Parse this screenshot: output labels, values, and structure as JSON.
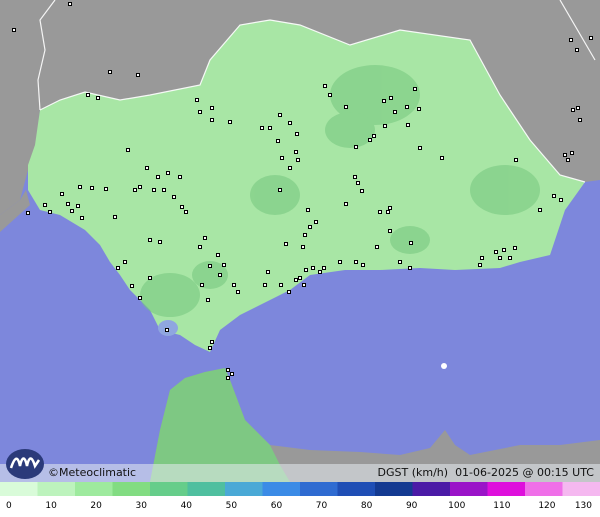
{
  "brand": {
    "name": "Meteoclimatic",
    "copyright_symbol": "©"
  },
  "stamp": {
    "variable": "DGST (km/h)",
    "datetime": "01-06-2025 @ 00:15 UTC"
  },
  "legend": {
    "ticks": [
      "0",
      "10",
      "20",
      "30",
      "40",
      "50",
      "60",
      "70",
      "80",
      "90",
      "100",
      "110",
      "120",
      "130"
    ],
    "colors": [
      "#d9fbd9",
      "#bdf3bd",
      "#9eea9e",
      "#82dc82",
      "#66cd8a",
      "#4fbf9f",
      "#4aa9d6",
      "#3b8be6",
      "#2f6bd1",
      "#1f4eb5",
      "#143a91",
      "#4b1aa6",
      "#9a14c8",
      "#de0fdc",
      "#ef6fe8",
      "#f5b8f0"
    ]
  },
  "colors": {
    "sea": "#7d87dc",
    "land_outside": "#9a9a9a",
    "andalusia": "#a8e6a5",
    "gusts": "#74c77e"
  }
}
